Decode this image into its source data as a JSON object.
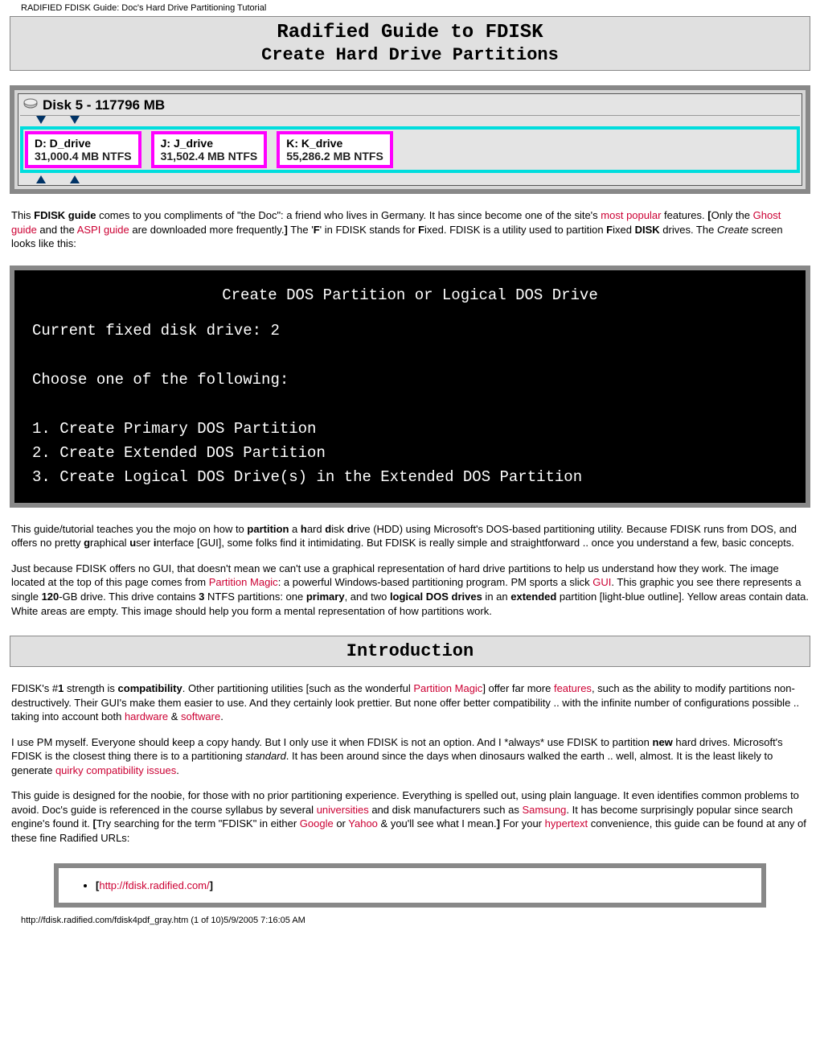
{
  "header": "RADIFIED FDISK Guide: Doc's Hard Drive Partitioning Tutorial",
  "title": {
    "line1": "Radified Guide to FDISK",
    "line2": "Create Hard Drive Partitions"
  },
  "disk": {
    "label": "Disk 5 - 117796 MB",
    "parts": [
      {
        "name": "D: D_drive",
        "size": "31,000.4 MB   NTFS"
      },
      {
        "name": "J: J_drive",
        "size": "31,502.4 MB   NTFS"
      },
      {
        "name": "K: K_drive",
        "size": "55,286.2 MB   NTFS"
      }
    ]
  },
  "p1": {
    "a": "This ",
    "b": "FDISK guide",
    "c": " comes to you compliments of \"the Doc\": a friend who lives in Germany. It has since become one of the site's ",
    "d": "most popular",
    "e": " features. ",
    "f": "[",
    "g": "Only the ",
    "h": "Ghost guide",
    "i": " and the ",
    "j": "ASPI guide",
    "k": " are downloaded more frequently.",
    "l": "]",
    "m": " The '",
    "n": "F",
    "o": "' in FDISK stands for ",
    "p": "F",
    "q": "ixed. FDISK is a utility used to partition ",
    "r": "F",
    "s": "ixed ",
    "t": "DISK",
    "u": " drives. The ",
    "v": "Create",
    "w": " screen looks like this:"
  },
  "dos": {
    "title": "Create DOS Partition or Logical DOS Drive",
    "l1": "Current fixed disk drive: 2",
    "l2": "Choose one of the following:",
    "o1": "1. Create Primary DOS Partition",
    "o2": "2. Create Extended DOS Partition",
    "o3": "3. Create Logical DOS Drive(s) in the Extended DOS Partition"
  },
  "p2": {
    "a": "This guide/tutorial teaches you the mojo on how to ",
    "b": "partition",
    "c": " a ",
    "d": "h",
    "e": "ard ",
    "f": "d",
    "g": "isk ",
    "h": "d",
    "i": "rive (HDD) using Microsoft's DOS-based partitioning utility. Because FDISK runs from DOS, and offers no pretty ",
    "j": "g",
    "k": "raphical ",
    "l": "u",
    "m": "ser ",
    "n": "i",
    "o": "nterface [GUI], some folks find it intimidating. But FDISK is really simple and straightforward .. once you understand a few, basic concepts."
  },
  "p3": {
    "a": "Just because FDISK offers no GUI, that doesn't mean we can't use a graphical representation of hard drive partitions to help us understand how they work. The image located at the top of this page comes from ",
    "b": "Partition Magic",
    "c": ": a powerful Windows-based partitioning program. PM sports a slick ",
    "d": "GUI",
    "e": ". This graphic you see there represents a single ",
    "f": "120",
    "g": "-GB drive. This drive contains ",
    "h": "3",
    "i": " NTFS partitions: one ",
    "j": "primary",
    "k": ", and two ",
    "l": "logical DOS drives",
    "m": " in an ",
    "n": "extended",
    "o": " partition [light-blue outline]. Yellow areas contain data. White areas are empty. This image should help you form a mental representation of how partitions work."
  },
  "intro_hdr": "Introduction",
  "p4": {
    "a": "FDISK's #",
    "b": "1",
    "c": " strength is ",
    "d": "compatibility",
    "e": ". Other partitioning utilities [such as the wonderful ",
    "f": "Partition Magic",
    "g": "] offer far more ",
    "h": "features",
    "i": ", such as the ability to modify partitions non-destructively. Their GUI's make them easier to use. And they certainly look prettier. But none offer better compatibility .. with the infinite number of configurations possible .. taking into account both ",
    "j": "hardware",
    "k": " & ",
    "l": "software",
    "m": "."
  },
  "p5": {
    "a": "I use PM myself. Everyone should keep a copy handy. But I only use it when FDISK is not an option. And I *always* use FDISK to partition ",
    "b": "new",
    "c": " hard drives. Microsoft's FDISK is the closest thing there is to a partitioning ",
    "d": "standard",
    "e": ". It has been around since the days when dinosaurs walked the earth .. well, almost. It is the least likely to generate ",
    "f": "quirky compatibility issues",
    "g": "."
  },
  "p6": {
    "a": "This guide is designed for the noobie, for those with no prior partitioning experience. Everything is spelled out, using plain language. It even identifies common problems to avoid. Doc's guide is referenced in the course syllabus by several ",
    "b": "universities",
    "c": " and disk manufacturers such as ",
    "d": "Samsung",
    "e": ". It has become surprisingly popular since search engine's found it. ",
    "f": "[",
    "g": "Try searching for the term \"FDISK\" in either ",
    "h": "Google",
    "i": " or ",
    "j": "Yahoo",
    "k": " & you'll see what I mean.",
    "l": "]",
    "m": " For your ",
    "n": "hypertext",
    "o": " convenience, this guide can be found at any of these fine Radified URLs:"
  },
  "url": {
    "b1": "[",
    "link": "http://fdisk.radified.com/",
    "b2": "]"
  },
  "footer": "http://fdisk.radified.com/fdisk4pdf_gray.htm (1 of 10)5/9/2005 7:16:05 AM"
}
